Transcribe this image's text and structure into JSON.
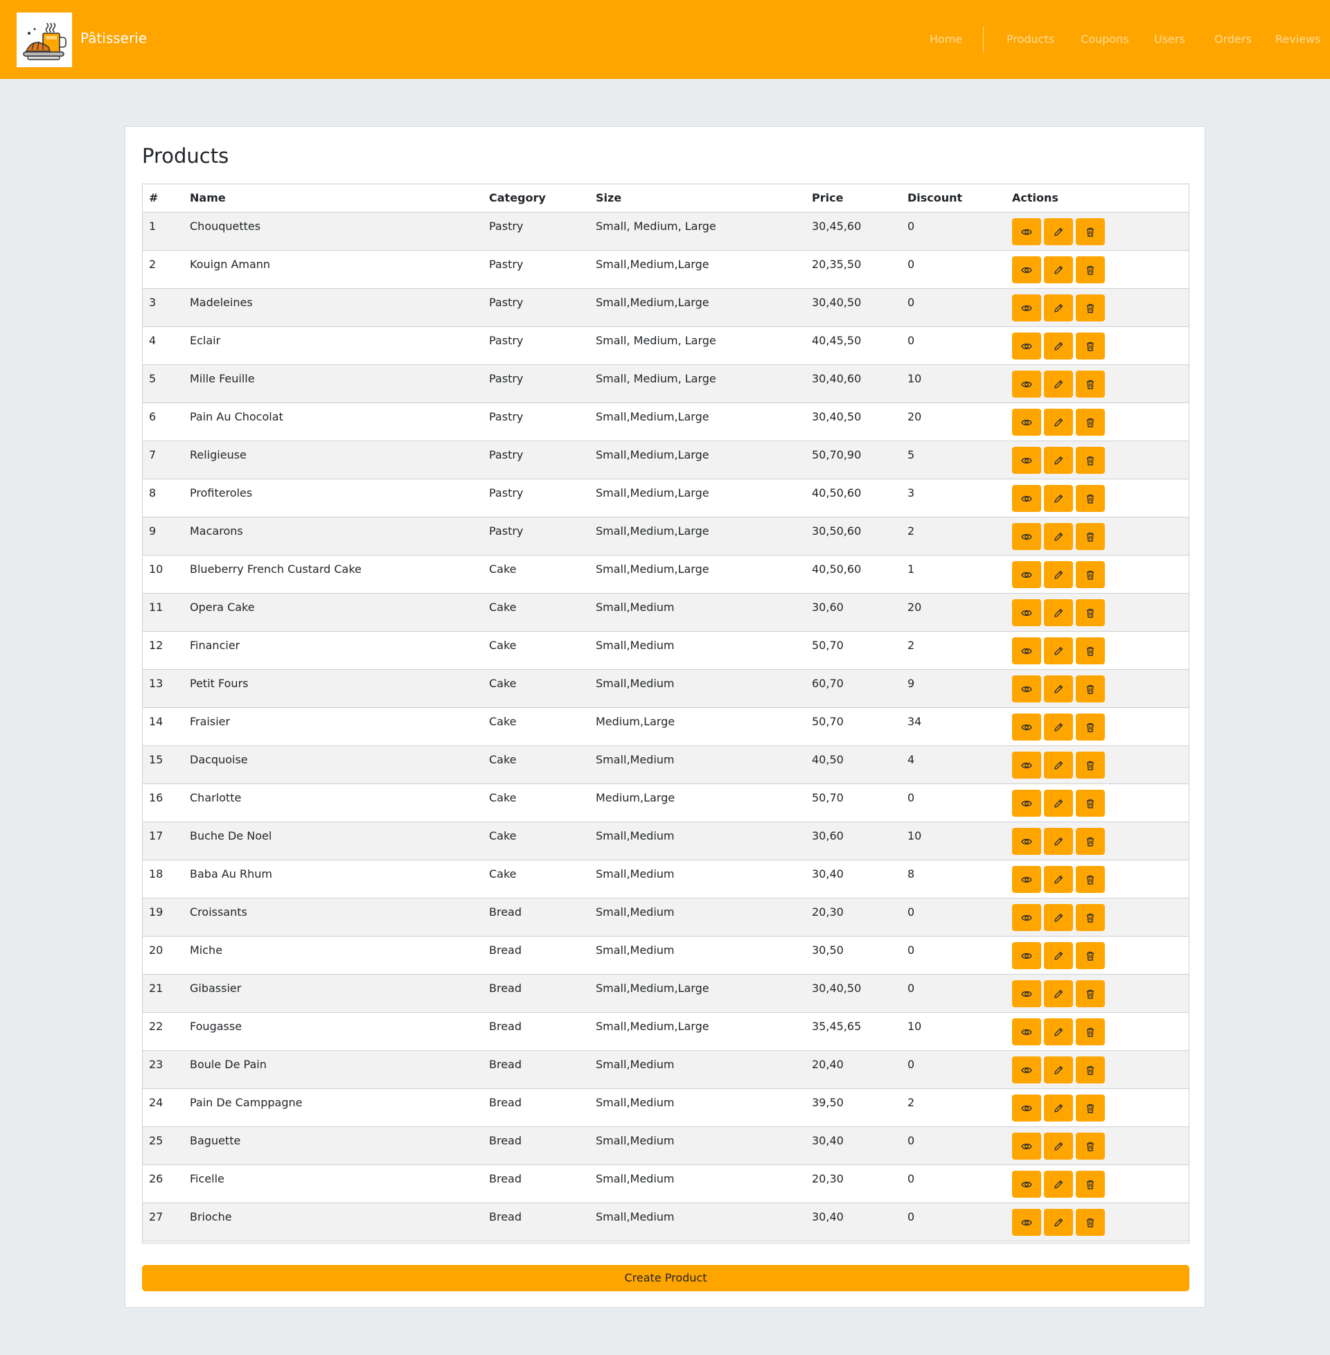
{
  "brand": {
    "name": "Pâtisserie",
    "logo_icon": "croissant-coffee-logo-icon"
  },
  "nav": {
    "items": [
      {
        "label": "Home"
      },
      {
        "label": "Products"
      },
      {
        "label": "Coupons"
      },
      {
        "label": "Users"
      },
      {
        "label": "Orders"
      },
      {
        "label": "Reviews"
      }
    ]
  },
  "colors": {
    "accent": "#ffa500",
    "page_background": "#e9ecef",
    "nav_text": "rgba(255,255,255,0.6)",
    "row_stripe": "#f2f2f2"
  },
  "main": {
    "title": "Products",
    "create_button": "Create Product"
  },
  "table": {
    "headers": [
      "#",
      "Name",
      "Category",
      "Size",
      "Price",
      "Discount",
      "Actions"
    ],
    "action_icons": [
      "eye-icon",
      "pencil-icon",
      "trash-icon"
    ],
    "rows": [
      {
        "num": "1",
        "name": "Chouquettes",
        "category": "Pastry",
        "size": "Small, Medium, Large",
        "price": "30,45,60",
        "discount": "0"
      },
      {
        "num": "2",
        "name": "Kouign Amann",
        "category": "Pastry",
        "size": "Small,Medium,Large",
        "price": "20,35,50",
        "discount": "0"
      },
      {
        "num": "3",
        "name": "Madeleines",
        "category": "Pastry",
        "size": "Small,Medium,Large",
        "price": "30,40,50",
        "discount": "0"
      },
      {
        "num": "4",
        "name": "Eclair",
        "category": "Pastry",
        "size": "Small, Medium, Large",
        "price": "40,45,50",
        "discount": "0"
      },
      {
        "num": "5",
        "name": "Mille Feuille",
        "category": "Pastry",
        "size": "Small, Medium, Large",
        "price": "30,40,60",
        "discount": "10"
      },
      {
        "num": "6",
        "name": "Pain Au Chocolat",
        "category": "Pastry",
        "size": "Small,Medium,Large",
        "price": "30,40,50",
        "discount": "20"
      },
      {
        "num": "7",
        "name": "Religieuse",
        "category": "Pastry",
        "size": "Small,Medium,Large",
        "price": "50,70,90",
        "discount": "5"
      },
      {
        "num": "8",
        "name": "Profiteroles",
        "category": "Pastry",
        "size": "Small,Medium,Large",
        "price": "40,50,60",
        "discount": "3"
      },
      {
        "num": "9",
        "name": "Macarons",
        "category": "Pastry",
        "size": "Small,Medium,Large",
        "price": "30,50,60",
        "discount": "2"
      },
      {
        "num": "10",
        "name": "Blueberry French Custard Cake",
        "category": "Cake",
        "size": "Small,Medium,Large",
        "price": "40,50,60",
        "discount": "1"
      },
      {
        "num": "11",
        "name": "Opera Cake",
        "category": "Cake",
        "size": "Small,Medium",
        "price": "30,60",
        "discount": "20"
      },
      {
        "num": "12",
        "name": "Financier",
        "category": "Cake",
        "size": "Small,Medium",
        "price": "50,70",
        "discount": "2"
      },
      {
        "num": "13",
        "name": "Petit Fours",
        "category": "Cake",
        "size": "Small,Medium",
        "price": "60,70",
        "discount": "9"
      },
      {
        "num": "14",
        "name": "Fraisier",
        "category": "Cake",
        "size": "Medium,Large",
        "price": "50,70",
        "discount": "34"
      },
      {
        "num": "15",
        "name": "Dacquoise",
        "category": "Cake",
        "size": "Small,Medium",
        "price": "40,50",
        "discount": "4"
      },
      {
        "num": "16",
        "name": "Charlotte",
        "category": "Cake",
        "size": "Medium,Large",
        "price": "50,70",
        "discount": "0"
      },
      {
        "num": "17",
        "name": "Buche De Noel",
        "category": "Cake",
        "size": "Small,Medium",
        "price": "30,60",
        "discount": "10"
      },
      {
        "num": "18",
        "name": "Baba Au Rhum",
        "category": "Cake",
        "size": "Small,Medium",
        "price": "30,40",
        "discount": "8"
      },
      {
        "num": "19",
        "name": "Croissants",
        "category": "Bread",
        "size": "Small,Medium",
        "price": "20,30",
        "discount": "0"
      },
      {
        "num": "20",
        "name": "Miche",
        "category": "Bread",
        "size": "Small,Medium",
        "price": "30,50",
        "discount": "0"
      },
      {
        "num": "21",
        "name": "Gibassier",
        "category": "Bread",
        "size": "Small,Medium,Large",
        "price": "30,40,50",
        "discount": "0"
      },
      {
        "num": "22",
        "name": "Fougasse",
        "category": "Bread",
        "size": "Small,Medium,Large",
        "price": "35,45,65",
        "discount": "10"
      },
      {
        "num": "23",
        "name": "Boule De Pain",
        "category": "Bread",
        "size": "Small,Medium",
        "price": "20,40",
        "discount": "0"
      },
      {
        "num": "24",
        "name": "Pain De Camppagne",
        "category": "Bread",
        "size": "Small,Medium",
        "price": "39,50",
        "discount": "2"
      },
      {
        "num": "25",
        "name": "Baguette",
        "category": "Bread",
        "size": "Small,Medium",
        "price": "30,40",
        "discount": "0"
      },
      {
        "num": "26",
        "name": "Ficelle",
        "category": "Bread",
        "size": "Small,Medium",
        "price": "20,30",
        "discount": "0"
      },
      {
        "num": "27",
        "name": "Brioche",
        "category": "Bread",
        "size": "Small,Medium",
        "price": "30,40",
        "discount": "0"
      }
    ]
  }
}
